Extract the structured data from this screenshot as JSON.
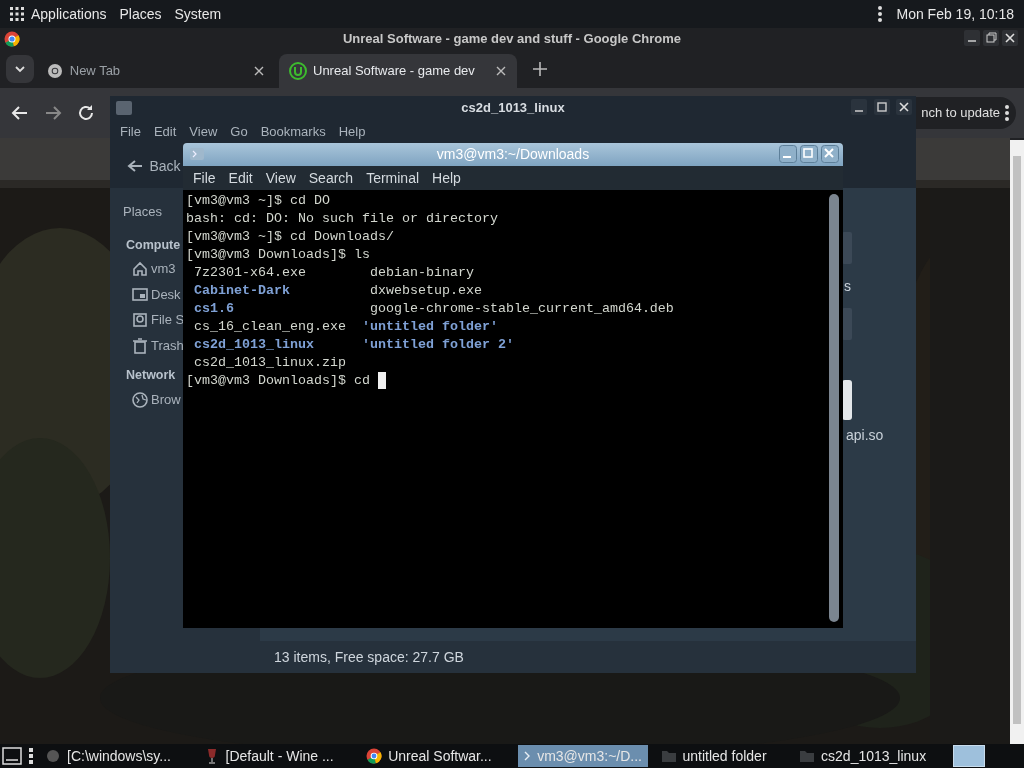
{
  "top_panel": {
    "menus": [
      "Applications",
      "Places",
      "System"
    ],
    "clock": "Mon Feb 19, 10:18"
  },
  "browser": {
    "title": "Unreal Software - game dev and stuff - Google Chrome",
    "tabs": [
      {
        "label": "New Tab",
        "selected": false
      },
      {
        "label": "Unreal Software - game dev",
        "selected": true
      }
    ],
    "update_text": "nch to update"
  },
  "file_manager": {
    "title": "cs2d_1013_linux",
    "menu": [
      "File",
      "Edit",
      "View",
      "Go",
      "Bookmarks",
      "Help"
    ],
    "back": "Back",
    "sidebar": [
      {
        "kind": "heading",
        "label": "Places"
      },
      {
        "kind": "section",
        "label": "Compute"
      },
      {
        "kind": "item",
        "label": "vm3"
      },
      {
        "kind": "item",
        "label": "Desk"
      },
      {
        "kind": "item",
        "label": "File S"
      },
      {
        "kind": "item",
        "label": "Trash"
      },
      {
        "kind": "section",
        "label": "Network"
      },
      {
        "kind": "item",
        "label": "Brow"
      }
    ],
    "files": [
      "s",
      "api.so"
    ],
    "status": "13 items, Free space: 27.7 GB"
  },
  "terminal": {
    "title": "vm3@vm3:~/Downloads",
    "menu": [
      "File",
      "Edit",
      "View",
      "Search",
      "Terminal",
      "Help"
    ],
    "lines": [
      {
        "kind": "text",
        "text": "[vm3@vm3 ~]$ cd DO"
      },
      {
        "kind": "text",
        "text": "bash: cd: DO: No such file or directory"
      },
      {
        "kind": "text",
        "text": "[vm3@vm3 ~]$ cd Downloads/"
      },
      {
        "kind": "text",
        "text": "[vm3@vm3 Downloads]$ ls"
      },
      {
        "kind": "listing",
        "cells": [
          {
            "text": "7z2301-x64.exe",
            "kind": "file"
          },
          {
            "text": "debian-binary",
            "kind": "file"
          }
        ]
      },
      {
        "kind": "listing",
        "cells": [
          {
            "text": "Cabinet-Dark",
            "kind": "dir"
          },
          {
            "text": "dxwebsetup.exe",
            "kind": "file"
          }
        ]
      },
      {
        "kind": "listing",
        "cells": [
          {
            "text": "cs1.6",
            "kind": "dir"
          },
          {
            "text": "google-chrome-stable_current_amd64.deb",
            "kind": "file"
          }
        ]
      },
      {
        "kind": "listing",
        "cells": [
          {
            "text": "cs_16_clean_eng.exe",
            "kind": "file"
          },
          {
            "text": "'untitled folder'",
            "kind": "quoted_dir"
          }
        ]
      },
      {
        "kind": "listing",
        "cells": [
          {
            "text": "cs2d_1013_linux",
            "kind": "dir"
          },
          {
            "text": "'untitled folder 2'",
            "kind": "quoted_dir"
          }
        ]
      },
      {
        "kind": "listing",
        "cells": [
          {
            "text": "cs2d_1013_linux.zip",
            "kind": "file"
          }
        ]
      },
      {
        "kind": "text",
        "text": "[vm3@vm3 Downloads]$ cd",
        "cursor": true
      }
    ]
  },
  "taskbar": {
    "items": [
      {
        "label": "[C:\\windows\\sy...",
        "selected": false
      },
      {
        "label": "[Default - Wine ...",
        "selected": false
      },
      {
        "label": "Unreal Softwar...",
        "selected": false
      },
      {
        "label": "vm3@vm3:~/D...",
        "selected": true
      },
      {
        "label": "untitled folder",
        "selected": false
      },
      {
        "label": "cs2d_1013_linux",
        "selected": false
      }
    ]
  }
}
